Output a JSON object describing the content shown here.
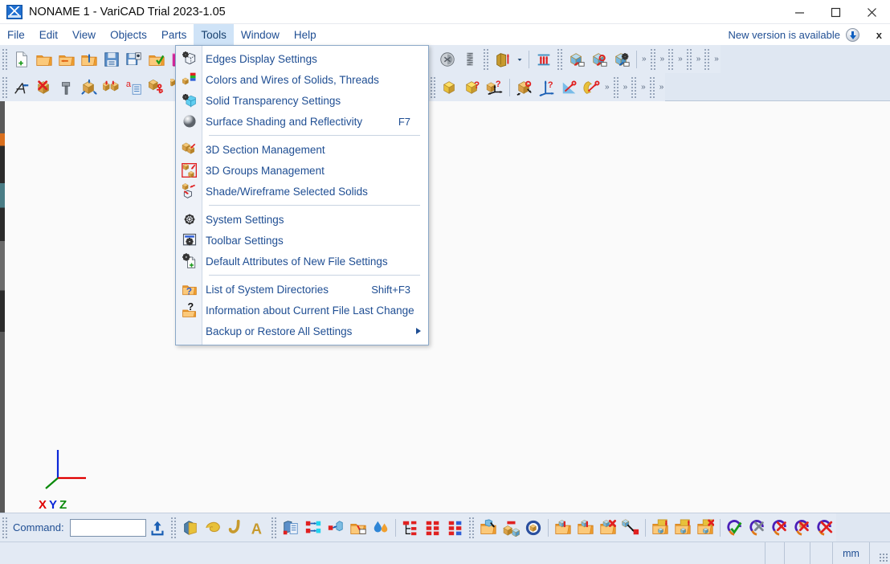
{
  "window": {
    "title": "NONAME 1 - VariCAD Trial 2023-1.05",
    "logo_name": "varicad-logo",
    "minimize_label": "Minimize",
    "maximize_label": "Maximize",
    "close_label": "Close"
  },
  "menubar": {
    "items": [
      {
        "label": "File",
        "active": false
      },
      {
        "label": "Edit",
        "active": false
      },
      {
        "label": "View",
        "active": false
      },
      {
        "label": "Objects",
        "active": false
      },
      {
        "label": "Parts",
        "active": false
      },
      {
        "label": "Tools",
        "active": true
      },
      {
        "label": "Window",
        "active": false
      },
      {
        "label": "Help",
        "active": false
      }
    ],
    "notice": "New version is available",
    "notice_close": "x"
  },
  "tools_menu": {
    "items": [
      {
        "label": "Edges Display Settings",
        "shortcut": "",
        "icon": "edges-display-icon",
        "submenu": false
      },
      {
        "label": "Colors and Wires of Solids, Threads",
        "shortcut": "",
        "icon": "colors-wires-icon",
        "submenu": false
      },
      {
        "label": "Solid Transparency Settings",
        "shortcut": "",
        "icon": "transparency-icon",
        "submenu": false
      },
      {
        "label": "Surface Shading and Reflectivity",
        "shortcut": "F7",
        "icon": "shading-sphere-icon",
        "submenu": false
      },
      {
        "separator": true
      },
      {
        "label": "3D Section Management",
        "shortcut": "",
        "icon": "section-mgmt-icon",
        "submenu": false
      },
      {
        "label": "3D Groups Management",
        "shortcut": "",
        "icon": "groups-mgmt-icon",
        "submenu": false
      },
      {
        "label": "Shade/Wireframe Selected Solids",
        "shortcut": "",
        "icon": "shade-wireframe-icon",
        "submenu": false
      },
      {
        "separator": true
      },
      {
        "label": "System Settings",
        "shortcut": "",
        "icon": "gear-icon",
        "submenu": false
      },
      {
        "label": "Toolbar Settings",
        "shortcut": "",
        "icon": "toolbar-settings-icon",
        "submenu": false
      },
      {
        "label": "Default Attributes of New File Settings",
        "shortcut": "",
        "icon": "new-file-settings-icon",
        "submenu": false
      },
      {
        "separator": true
      },
      {
        "label": "List of System Directories",
        "shortcut": "Shift+F3",
        "icon": "folder-help-icon",
        "submenu": false
      },
      {
        "label": "Information about Current File Last Change",
        "shortcut": "",
        "icon": "folder-question-icon",
        "submenu": false
      },
      {
        "label": "Backup or Restore All Settings",
        "shortcut": "",
        "icon": "",
        "submenu": true
      }
    ]
  },
  "toolbar_row1": [
    {
      "type": "grip"
    },
    {
      "type": "btn",
      "icon": "new-file-icon"
    },
    {
      "type": "btn",
      "icon": "open-folder-icon"
    },
    {
      "type": "btn",
      "icon": "import-folder-icon"
    },
    {
      "type": "btn",
      "icon": "export-folder-icon"
    },
    {
      "type": "btn",
      "icon": "save-icon"
    },
    {
      "type": "btn",
      "icon": "save-as-icon"
    },
    {
      "type": "btn",
      "icon": "save-check-icon"
    },
    {
      "type": "btn",
      "icon": "varicad-pink-icon"
    },
    {
      "type": "grip"
    },
    {
      "type": "btn",
      "icon": "box-solid-icon"
    },
    {
      "type": "btn",
      "icon": "cylinder-icon"
    },
    {
      "type": "btn",
      "icon": "cone-icon"
    },
    {
      "type": "btn",
      "icon": "prism-icon"
    },
    {
      "type": "btn",
      "icon": "tube-icon"
    },
    {
      "type": "btn",
      "icon": "truncated-cone-icon"
    },
    {
      "type": "btn",
      "icon": "elbow-icon"
    },
    {
      "type": "btn",
      "icon": "elbow2-icon"
    },
    {
      "type": "btn",
      "icon": "sphere-icon"
    },
    {
      "type": "grip"
    },
    {
      "type": "btn",
      "icon": "thread-bolt-icon"
    },
    {
      "type": "btn",
      "icon": "thread-disc-icon"
    },
    {
      "type": "btn",
      "icon": "spring-icon"
    },
    {
      "type": "grip"
    },
    {
      "type": "btn",
      "icon": "extrude-icon"
    },
    {
      "type": "btn",
      "icon": "extrude-dropdown-icon"
    },
    {
      "type": "sep"
    },
    {
      "type": "btn",
      "icon": "revolve-icon"
    },
    {
      "type": "grip"
    },
    {
      "type": "btn",
      "icon": "blend-edge-icon"
    },
    {
      "type": "btn",
      "icon": "chamfer-edge-icon"
    },
    {
      "type": "btn",
      "icon": "shell-edge-icon"
    },
    {
      "type": "sep"
    },
    {
      "type": "chev",
      "label": "»"
    },
    {
      "type": "grip"
    },
    {
      "type": "chev",
      "label": "»"
    },
    {
      "type": "grip"
    },
    {
      "type": "chev",
      "label": "»"
    },
    {
      "type": "grip"
    },
    {
      "type": "chev",
      "label": "»"
    },
    {
      "type": "grip"
    },
    {
      "type": "chev",
      "label": "»"
    }
  ],
  "toolbar_row2": [
    {
      "type": "grip"
    },
    {
      "type": "btn",
      "icon": "snap-point-icon"
    },
    {
      "type": "btn",
      "icon": "delete-solid-icon"
    },
    {
      "type": "btn",
      "icon": "hammer-icon"
    },
    {
      "type": "btn",
      "icon": "move-solid-icon"
    },
    {
      "type": "btn",
      "icon": "copy-solid-icon"
    },
    {
      "type": "btn",
      "icon": "attributes-icon"
    },
    {
      "type": "btn",
      "icon": "anchor-solid-icon"
    },
    {
      "type": "btn",
      "icon": "anchor-copy-icon"
    },
    {
      "type": "grip"
    },
    {
      "type": "btn",
      "icon": "cut-solid-icon"
    },
    {
      "type": "btn",
      "icon": "slice-solid-icon"
    },
    {
      "type": "grip"
    },
    {
      "type": "btn",
      "icon": "boolean-add-icon"
    },
    {
      "type": "btn",
      "icon": "boolean-subtract-icon"
    },
    {
      "type": "btn",
      "icon": "boolean-intersect-icon"
    },
    {
      "type": "sep"
    },
    {
      "type": "btn",
      "icon": "boolean-add-up-icon"
    },
    {
      "type": "btn",
      "icon": "boolean-subtract-up-icon"
    },
    {
      "type": "btn",
      "icon": "boolean-intersect-up-icon"
    },
    {
      "type": "sep"
    },
    {
      "type": "btn",
      "icon": "overlap-icon"
    },
    {
      "type": "grip"
    },
    {
      "type": "btn",
      "icon": "yellow-cube-icon"
    },
    {
      "type": "btn",
      "icon": "cube-help-icon"
    },
    {
      "type": "btn",
      "icon": "cube-axis-help-icon"
    },
    {
      "type": "sep"
    },
    {
      "type": "btn",
      "icon": "rotate-help-icon"
    },
    {
      "type": "btn",
      "icon": "axis-help-icon"
    },
    {
      "type": "btn",
      "icon": "measure-angle-icon"
    },
    {
      "type": "btn",
      "icon": "measure-arc-icon"
    },
    {
      "type": "chev",
      "label": "»"
    },
    {
      "type": "grip"
    },
    {
      "type": "chev",
      "label": "»"
    },
    {
      "type": "grip"
    },
    {
      "type": "chev",
      "label": "»"
    },
    {
      "type": "grip"
    },
    {
      "type": "chev",
      "label": "»"
    }
  ],
  "bottom_toolbar": [
    {
      "type": "grip"
    },
    {
      "type": "label",
      "text": "Command:"
    },
    {
      "type": "cmdinput",
      "value": "",
      "placeholder": ""
    },
    {
      "type": "btn",
      "icon": "command-run-icon"
    },
    {
      "type": "grip"
    },
    {
      "type": "btn",
      "icon": "solid-view-icon"
    },
    {
      "type": "btn",
      "icon": "surface-icon"
    },
    {
      "type": "btn",
      "icon": "curve-icon"
    },
    {
      "type": "btn",
      "icon": "text-a-icon"
    },
    {
      "type": "grip"
    },
    {
      "type": "btn",
      "icon": "copy-properties-icon"
    },
    {
      "type": "btn",
      "icon": "link-objects-icon"
    },
    {
      "type": "btn",
      "icon": "link-single-icon"
    },
    {
      "type": "btn",
      "icon": "export-drawing-icon"
    },
    {
      "type": "btn",
      "icon": "material-drop-icon"
    },
    {
      "type": "sep"
    },
    {
      "type": "btn",
      "icon": "tree-structure-icon"
    },
    {
      "type": "btn",
      "icon": "bom-list-icon"
    },
    {
      "type": "btn",
      "icon": "bom-compare-icon"
    },
    {
      "type": "grip"
    },
    {
      "type": "btn",
      "icon": "open-part-icon"
    },
    {
      "type": "btn",
      "icon": "insert-part-icon"
    },
    {
      "type": "btn",
      "icon": "part-library-icon"
    },
    {
      "type": "sep"
    },
    {
      "type": "btn",
      "icon": "part-download-icon"
    },
    {
      "type": "btn",
      "icon": "part-upload-icon"
    },
    {
      "type": "btn",
      "icon": "part-remove-icon"
    },
    {
      "type": "btn",
      "icon": "part-extract-icon"
    },
    {
      "type": "sep"
    },
    {
      "type": "btn",
      "icon": "link-download-icon"
    },
    {
      "type": "btn",
      "icon": "link-upload-icon"
    },
    {
      "type": "btn",
      "icon": "link-break-icon"
    },
    {
      "type": "sep"
    },
    {
      "type": "btn",
      "icon": "confirm-icon"
    },
    {
      "type": "btn",
      "icon": "cancel-gray-icon"
    },
    {
      "type": "btn",
      "icon": "cancel-red-icon"
    },
    {
      "type": "btn",
      "icon": "cancel-orange-icon"
    },
    {
      "type": "btn",
      "icon": "cancel-all-icon"
    }
  ],
  "viewport": {
    "axis": {
      "x_label": "X",
      "y_label": "Y",
      "z_label": "Z",
      "x_color": "#e00000",
      "y_color": "#0a26d8",
      "z_color": "#0a8a0a"
    }
  },
  "statusbar": {
    "cells": [
      "",
      "",
      "",
      ""
    ],
    "units": "mm"
  }
}
